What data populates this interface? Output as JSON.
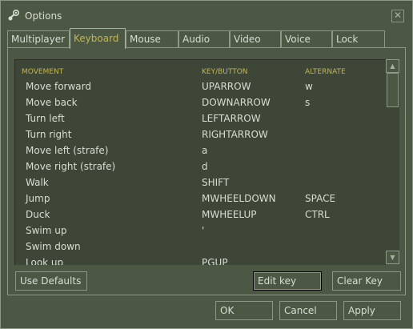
{
  "window": {
    "title": "Options",
    "close_label": "✕"
  },
  "tabs": [
    {
      "label": "Multiplayer",
      "active": false
    },
    {
      "label": "Keyboard",
      "active": true
    },
    {
      "label": "Mouse",
      "active": false
    },
    {
      "label": "Audio",
      "active": false
    },
    {
      "label": "Video",
      "active": false
    },
    {
      "label": "Voice",
      "active": false
    },
    {
      "label": "Lock",
      "active": false
    }
  ],
  "list": {
    "headers": {
      "action": "MOVEMENT",
      "key": "KEY/BUTTON",
      "alternate": "ALTERNATE"
    },
    "rows": [
      {
        "action": "Move forward",
        "key": "UPARROW",
        "alternate": "w"
      },
      {
        "action": "Move back",
        "key": "DOWNARROW",
        "alternate": "s"
      },
      {
        "action": "Turn left",
        "key": "LEFTARROW",
        "alternate": ""
      },
      {
        "action": "Turn right",
        "key": "RIGHTARROW",
        "alternate": ""
      },
      {
        "action": "Move left (strafe)",
        "key": "a",
        "alternate": ""
      },
      {
        "action": "Move right (strafe)",
        "key": "d",
        "alternate": ""
      },
      {
        "action": "Walk",
        "key": "SHIFT",
        "alternate": ""
      },
      {
        "action": "Jump",
        "key": "MWHEELDOWN",
        "alternate": "SPACE"
      },
      {
        "action": "Duck",
        "key": "MWHEELUP",
        "alternate": "CTRL"
      },
      {
        "action": "Swim up",
        "key": "'",
        "alternate": ""
      },
      {
        "action": "Swim down",
        "key": "",
        "alternate": ""
      },
      {
        "action": "Look up",
        "key": "PGUP",
        "alternate": ""
      }
    ]
  },
  "scrollbar": {
    "up_arrow": "▲",
    "down_arrow": "▼"
  },
  "buttons": {
    "use_defaults": "Use Defaults",
    "edit_key": "Edit key",
    "clear_key": "Clear Key",
    "ok": "OK",
    "cancel": "Cancel",
    "apply": "Apply"
  },
  "colors": {
    "background": "#4c5844",
    "list_background": "#3e4637",
    "text": "#d8ded3",
    "accent": "#c4b550",
    "border": "#8c9884"
  },
  "icons": {
    "title": "steam-logo-icon"
  }
}
